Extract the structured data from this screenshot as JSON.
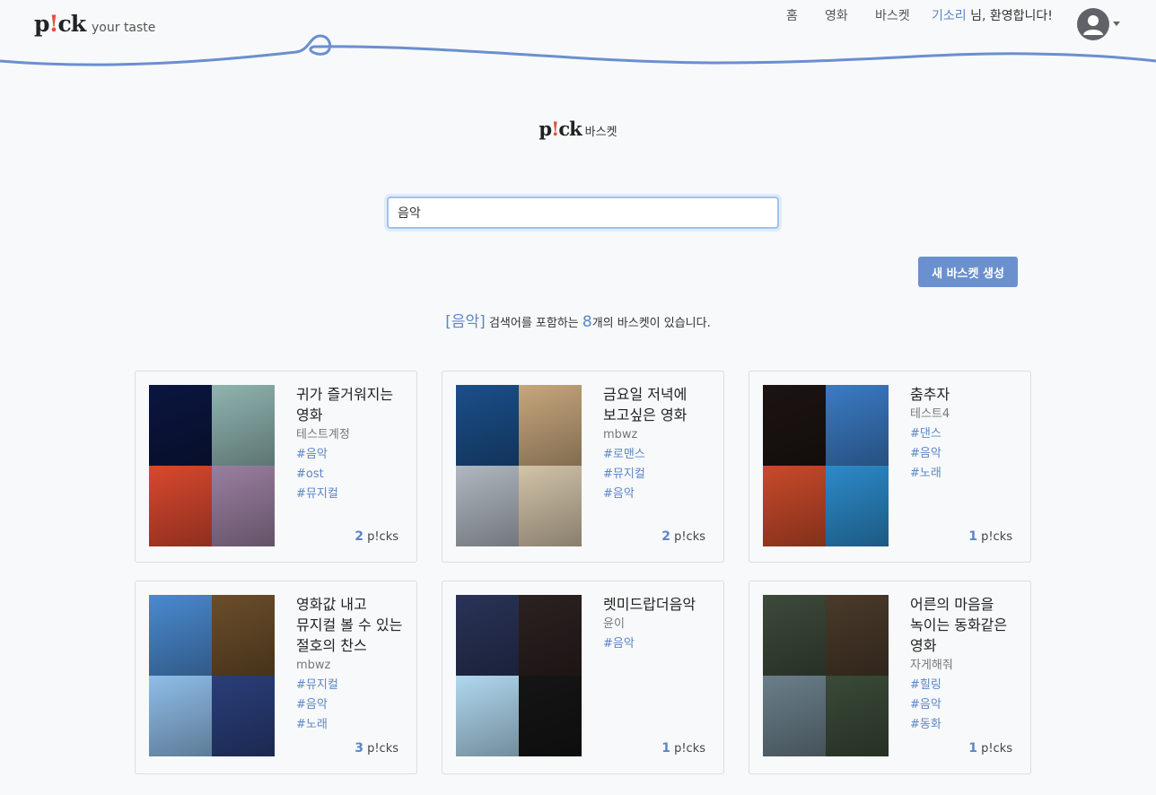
{
  "header": {
    "logo_text_a": "p",
    "logo_text_bang": "!",
    "logo_text_b": "ck",
    "tagline": "your taste",
    "nav": [
      "홈",
      "영화",
      "바스켓"
    ],
    "user_name": "기소리",
    "greeting": " 님, 환영합니다!",
    "avatar_icon": "user-avatar-icon"
  },
  "page": {
    "title_a": "p",
    "title_bang": "!",
    "title_b": "ck",
    "title_sub": "바스켓",
    "search_value": "음악",
    "new_button": "새 바스켓 생성",
    "result_keyword": "[음악]",
    "result_mid": " 검색어를 포함하는 ",
    "result_count": "8",
    "result_end": "개의 바스켓이 있습니다."
  },
  "colors": {
    "accent": "#5b86c7",
    "button": "#6b90cf",
    "wave": "#6a8fd0",
    "logo_bang": "#e74c3c"
  },
  "picks_label": "p!cks",
  "cards": [
    {
      "title": "귀가 즐거워지는 영화",
      "author": "테스트계정",
      "tags": [
        "#음악",
        "#ost",
        "#뮤지컬"
      ],
      "picks": "2",
      "thumbs": [
        "#0b1640",
        "#8fb4b0",
        "#d9482e",
        "#9a7fa0"
      ]
    },
    {
      "title": "금요일 저녁에 보고싶은 영화",
      "author": "mbwz",
      "tags": [
        "#로맨스",
        "#뮤지컬",
        "#음악"
      ],
      "picks": "2",
      "thumbs": [
        "#1b4f8a",
        "#c7a77c",
        "#b0b7c0",
        "#d2c3a8"
      ]
    },
    {
      "title": "춤추자",
      "author": "테스트4",
      "tags": [
        "#댄스",
        "#음악",
        "#노래"
      ],
      "picks": "1",
      "thumbs": [
        "#1c1412",
        "#3b7bc4",
        "#c84a2a",
        "#2c8ac9"
      ]
    },
    {
      "title": "영화값 내고 뮤지컬 볼 수 있는 절호의 찬스",
      "author": "mbwz",
      "tags": [
        "#뮤지컬",
        "#음악",
        "#노래"
      ],
      "picks": "3",
      "thumbs": [
        "#4a8ad0",
        "#6b4e2a",
        "#8fbde8",
        "#2a3e7a"
      ]
    },
    {
      "title": "렛미드랍더음악",
      "author": "윤이",
      "tags": [
        "#음악"
      ],
      "picks": "1",
      "thumbs": [
        "#2a3358",
        "#2b2120",
        "#b0d8ef",
        "#151515"
      ]
    },
    {
      "title": "어른의 마음을 녹이는 동화같은 영화",
      "author": "자게해줘",
      "tags": [
        "#힐링",
        "#음악",
        "#동화"
      ],
      "picks": "1",
      "thumbs": [
        "#3d4a3a",
        "#4a3a2a",
        "#6a7f8a",
        "#3a4a38"
      ]
    }
  ]
}
